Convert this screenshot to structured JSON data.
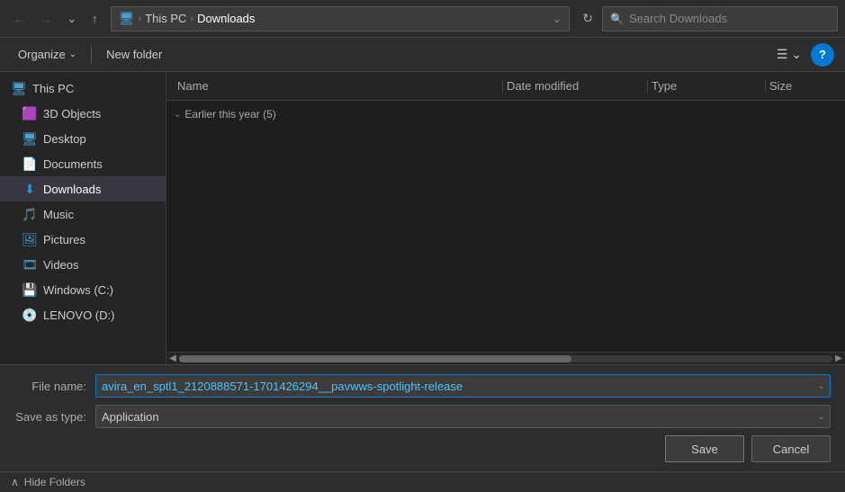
{
  "topbar": {
    "nav_back_disabled": true,
    "nav_forward_disabled": true,
    "breadcrumb": {
      "icon": "🖥",
      "path_items": [
        "This PC",
        "Downloads"
      ],
      "separator": "›"
    },
    "search_placeholder": "Search Downloads"
  },
  "toolbar": {
    "organize_label": "Organize",
    "new_folder_label": "New folder",
    "help_label": "?"
  },
  "sidebar": {
    "root_label": "This PC",
    "items": [
      {
        "id": "3d-objects",
        "label": "3D Objects",
        "icon": "🟪"
      },
      {
        "id": "desktop",
        "label": "Desktop",
        "icon": "🖥"
      },
      {
        "id": "documents",
        "label": "Documents",
        "icon": "📄"
      },
      {
        "id": "downloads",
        "label": "Downloads",
        "icon": "⬇",
        "active": true
      },
      {
        "id": "music",
        "label": "Music",
        "icon": "🎵"
      },
      {
        "id": "pictures",
        "label": "Pictures",
        "icon": "🖼"
      },
      {
        "id": "videos",
        "label": "Videos",
        "icon": "🎞"
      },
      {
        "id": "windows-c",
        "label": "Windows (C:)",
        "icon": "💾"
      },
      {
        "id": "lenovo-d",
        "label": "LENOVO (D:)",
        "icon": "💿"
      }
    ]
  },
  "columns": {
    "name": "Name",
    "date_modified": "Date modified",
    "type": "Type",
    "size": "Size"
  },
  "file_list": {
    "group_header": "Earlier this year (5)",
    "group_expanded": true
  },
  "bottom": {
    "file_name_label": "File name:",
    "file_name_value": "avira_en_sptl1_2120888571-1701426294__pavwws-spotlight-release",
    "save_as_type_label": "Save as type:",
    "save_as_type_value": "Application",
    "save_label": "Save",
    "cancel_label": "Cancel"
  },
  "hide_folders": {
    "label": "Hide Folders",
    "chevron": "∧"
  }
}
